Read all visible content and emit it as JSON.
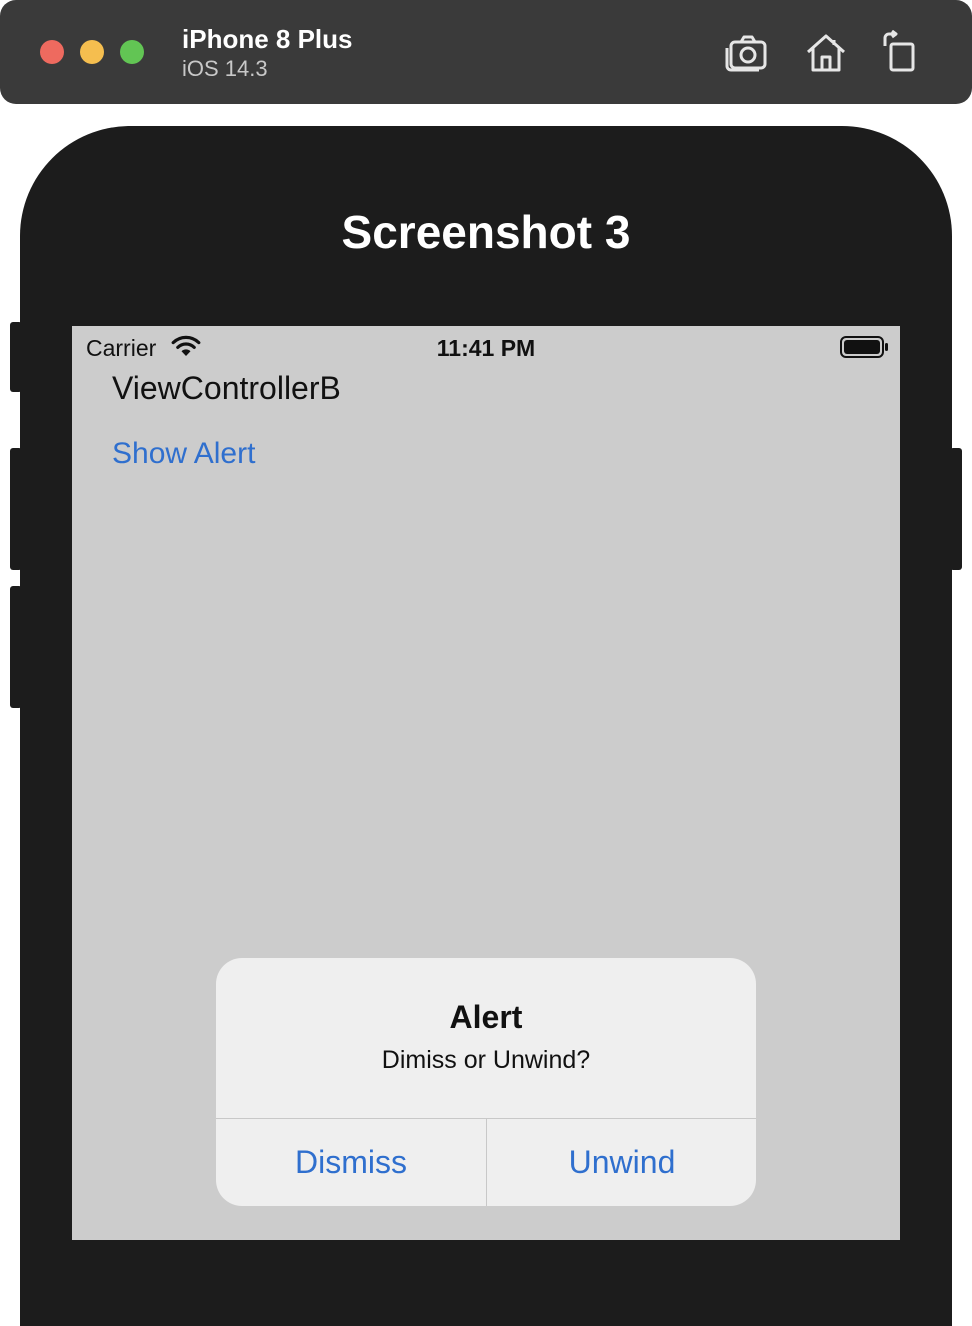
{
  "simulator": {
    "device_name": "iPhone 8 Plus",
    "os_version": "iOS 14.3",
    "toolbar_icons": [
      "screenshot-icon",
      "home-icon",
      "rotate-icon"
    ]
  },
  "device": {
    "title": "Screenshot 3"
  },
  "status_bar": {
    "carrier": "Carrier",
    "time": "11:41 PM",
    "icons": [
      "wifi-icon",
      "battery-icon"
    ]
  },
  "screen": {
    "view_label": "ViewControllerB",
    "show_alert_label": "Show Alert"
  },
  "alert": {
    "title": "Alert",
    "message": "Dimiss or Unwind?",
    "buttons": [
      "Dismiss",
      "Unwind"
    ]
  },
  "colors": {
    "link_blue": "#2f6fce",
    "screen_bg": "#cccccc",
    "device_body": "#1c1c1c"
  }
}
